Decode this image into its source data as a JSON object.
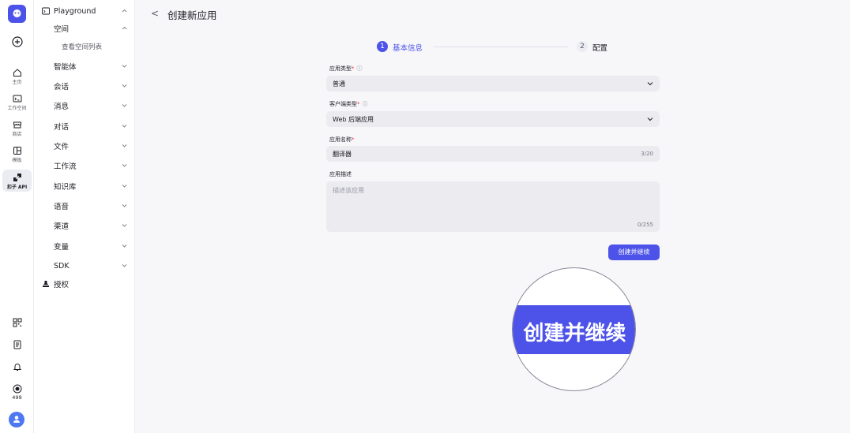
{
  "rail": {
    "items": [
      {
        "icon": "home-icon",
        "label": "主页"
      },
      {
        "icon": "terminal-icon",
        "label": "工作空间"
      },
      {
        "icon": "store-icon",
        "label": "商店"
      },
      {
        "icon": "template-icon",
        "label": "模板"
      },
      {
        "icon": "api-icon",
        "label": "扣子 API"
      }
    ],
    "bottom": {
      "credits": "499"
    }
  },
  "nav": {
    "section": "Playground",
    "space": "空间",
    "space_sub": "查看空间列表",
    "items": [
      "智能体",
      "会话",
      "消息",
      "对话",
      "文件",
      "工作流",
      "知识库",
      "语音",
      "渠道",
      "变量",
      "SDK"
    ],
    "auth": "授权"
  },
  "header": {
    "back": "<",
    "title": "创建新应用"
  },
  "steps": [
    {
      "num": "1",
      "label": "基本信息",
      "active": true
    },
    {
      "num": "2",
      "label": "配置",
      "active": false
    }
  ],
  "form": {
    "app_type": {
      "label": "应用类型",
      "value": "普通"
    },
    "client_type": {
      "label": "客户端类型",
      "value": "Web 后端应用"
    },
    "app_name": {
      "label": "应用名称",
      "value": "翻译器",
      "count": "3/20"
    },
    "app_desc": {
      "label": "应用描述",
      "placeholder": "描述该应用",
      "count": "0/255"
    },
    "required_mark": "*",
    "info_mark": "ⓘ"
  },
  "submit_label": "创建并继续",
  "magnifier_label": "创建并继续",
  "colors": {
    "accent": "#4d53e8",
    "required": "#e53241"
  }
}
